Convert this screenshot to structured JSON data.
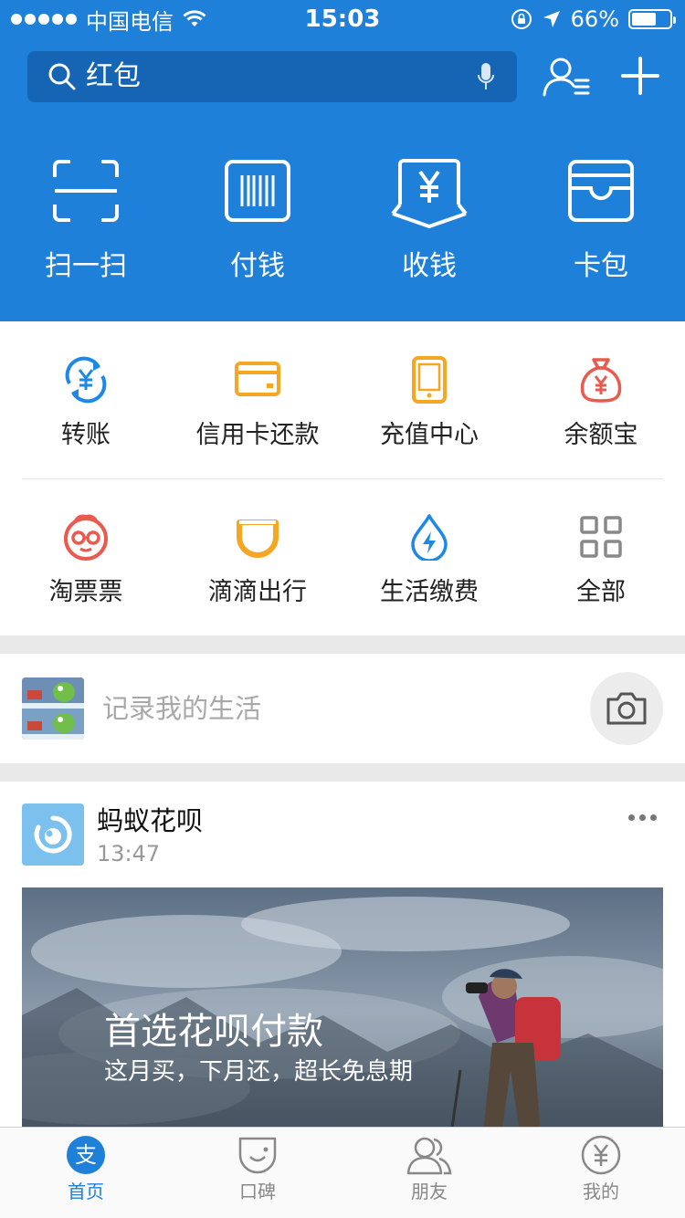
{
  "status_bar": {
    "carrier": "中国电信",
    "time": "15:03",
    "battery": "66%",
    "battery_level": 0.66,
    "icons": [
      "signal-dots",
      "wifi-icon",
      "rotation-lock-icon",
      "location-arrow-icon",
      "battery-icon"
    ]
  },
  "search": {
    "placeholder": "红包",
    "icons": [
      "search-icon",
      "microphone-icon"
    ]
  },
  "header_actions": [
    "contacts-icon",
    "plus-icon"
  ],
  "quick_actions": [
    {
      "label": "扫一扫",
      "icon": "scan-icon"
    },
    {
      "label": "付钱",
      "icon": "barcode-icon"
    },
    {
      "label": "收钱",
      "icon": "receive-money-icon"
    },
    {
      "label": "卡包",
      "icon": "wallet-icon"
    }
  ],
  "services": [
    {
      "label": "转账",
      "icon": "transfer-icon",
      "color": "#1e88e5"
    },
    {
      "label": "信用卡还款",
      "icon": "credit-card-icon",
      "color": "#f5a623"
    },
    {
      "label": "充值中心",
      "icon": "phone-icon",
      "color": "#f5a623"
    },
    {
      "label": "余额宝",
      "icon": "money-bag-icon",
      "color": "#e95a4f"
    },
    {
      "label": "淘票票",
      "icon": "taopiaopiao-icon",
      "color": "#e95a4f"
    },
    {
      "label": "滴滴出行",
      "icon": "didi-icon",
      "color": "#f5a623"
    },
    {
      "label": "生活缴费",
      "icon": "utility-drop-icon",
      "color": "#1e88e5"
    },
    {
      "label": "全部",
      "icon": "grid-icon",
      "color": "#888888"
    }
  ],
  "record": {
    "placeholder": "记录我的生活",
    "icons": [
      "avatar",
      "camera-icon"
    ]
  },
  "feed_card": {
    "title": "蚂蚁花呗",
    "time": "13:47",
    "banner_title": "首选花呗付款",
    "banner_subtitle": "这月买，下月还，超长免息期",
    "icons": [
      "huabei-logo-icon",
      "more-icon"
    ]
  },
  "tabs": [
    {
      "label": "首页",
      "icon": "alipay-home-icon",
      "active": true
    },
    {
      "label": "口碑",
      "icon": "koubei-icon",
      "active": false
    },
    {
      "label": "朋友",
      "icon": "friends-icon",
      "active": false
    },
    {
      "label": "我的",
      "icon": "my-yuan-icon",
      "active": false
    }
  ],
  "colors": {
    "brand_blue": "#1e80d8",
    "search_bg": "#1664b4",
    "separator": "#e9e9e9"
  }
}
